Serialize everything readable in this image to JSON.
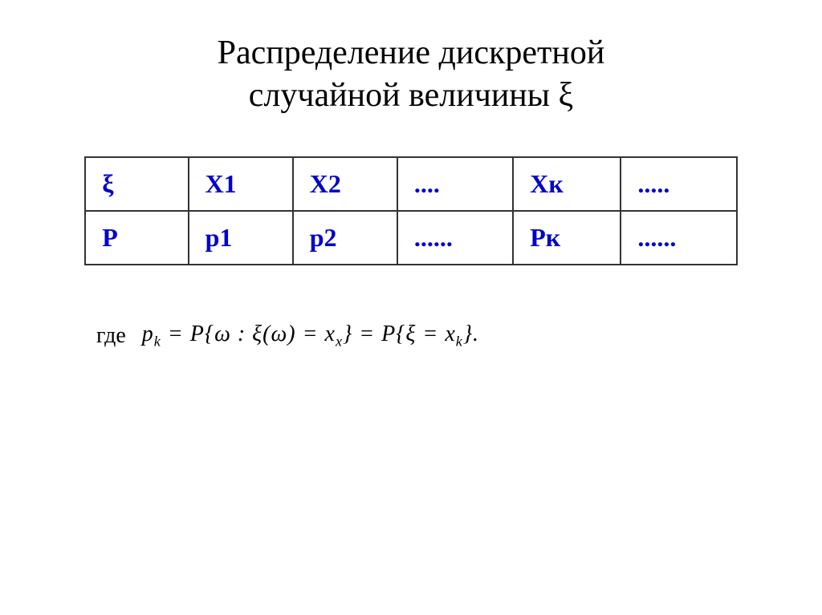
{
  "title": {
    "line1": "Распределение дискретной",
    "line2": "случайной величины ξ"
  },
  "table": {
    "rows": [
      {
        "col1": "ξ",
        "col2": "X1",
        "col3": "X2",
        "col4": "....",
        "col5": "Xк",
        "col6": "....."
      },
      {
        "col1": "P",
        "col2": "p1",
        "col3": "p2",
        "col4": "......",
        "col5": "Pк",
        "col6": "......"
      }
    ]
  },
  "formula": {
    "label": "где",
    "expression": "pₖ = P{ω : ξ(ω) = xₓ} = P{ξ = xₖ}."
  }
}
